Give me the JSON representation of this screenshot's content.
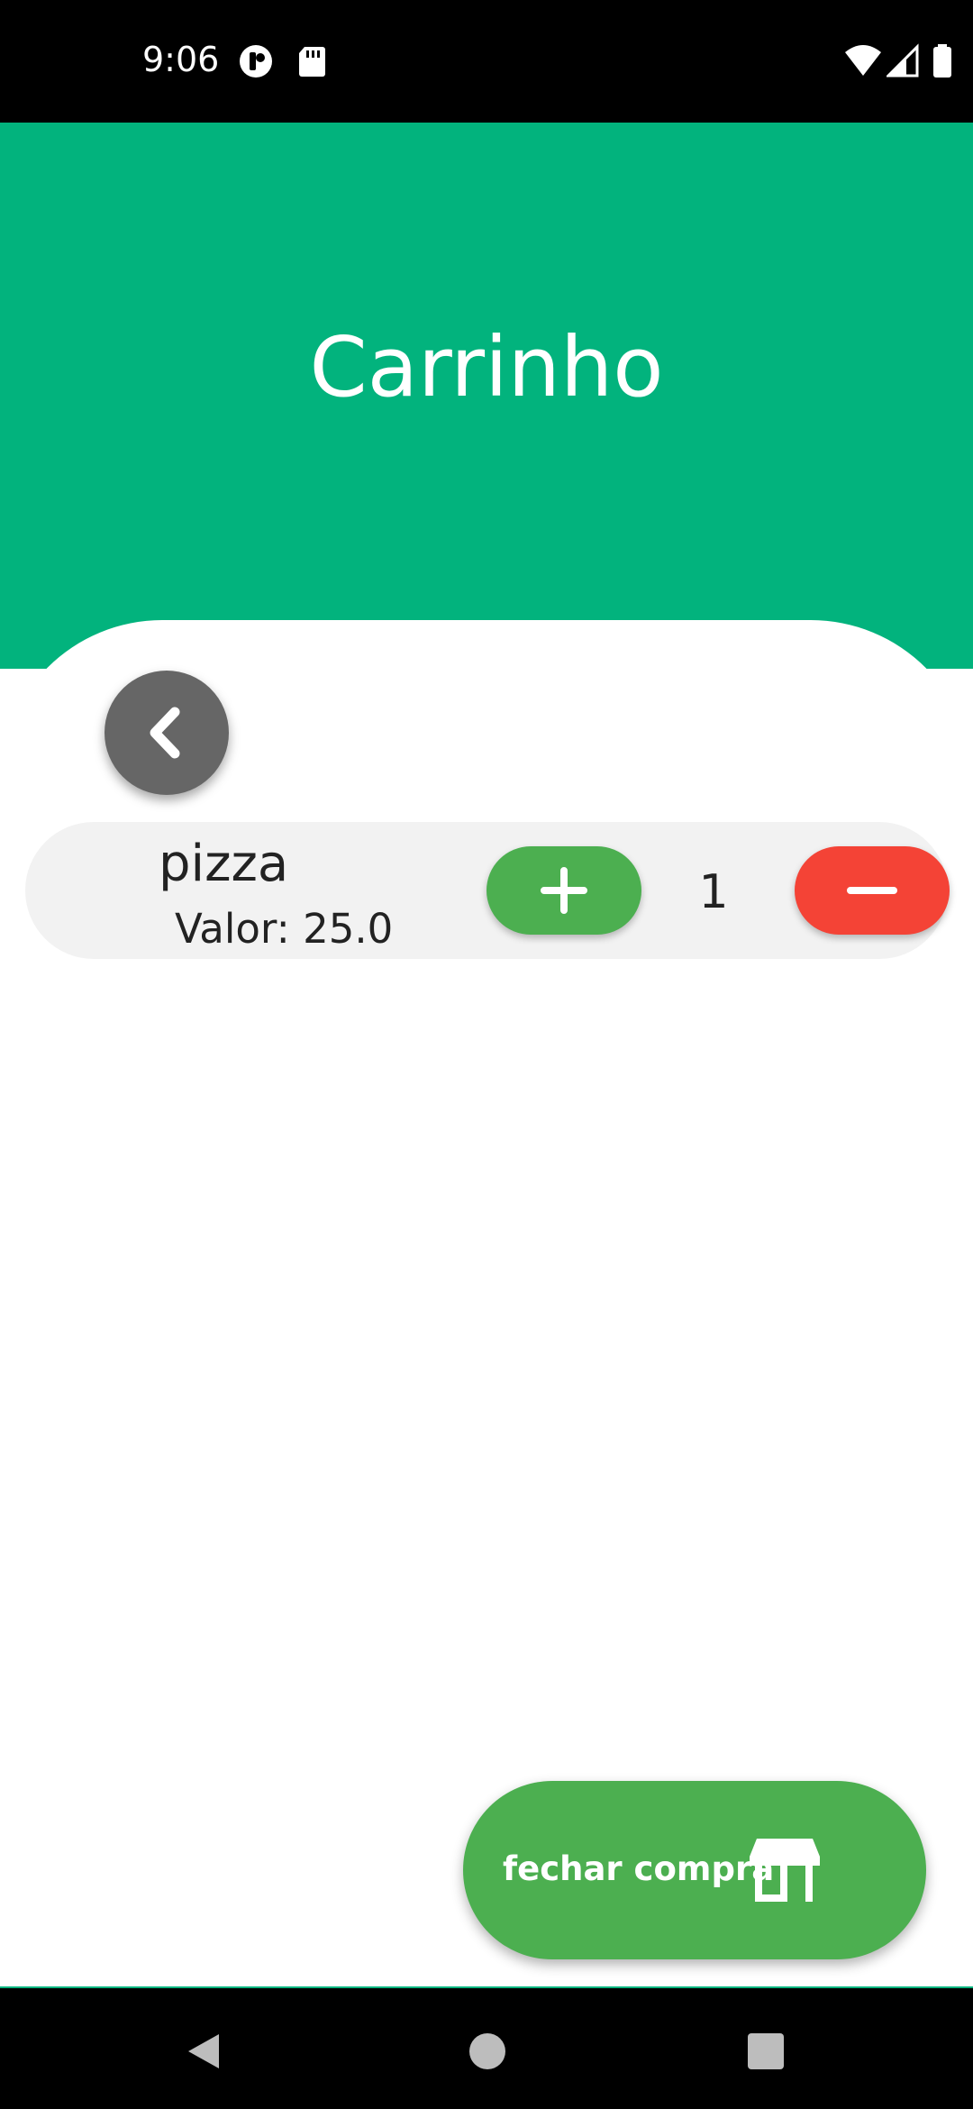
{
  "status_bar": {
    "time": "9:06",
    "icons": [
      "app-notification-icon",
      "sd-card-icon",
      "wifi-icon",
      "cell-signal-icon",
      "battery-icon"
    ]
  },
  "header": {
    "title": "Carrinho",
    "color": "#02b37d"
  },
  "back_button": {
    "icon": "chevron-left-icon",
    "color": "#666666"
  },
  "cart": {
    "items": [
      {
        "name": "pizza",
        "price_label": "Valor: 25.0",
        "quantity": "1"
      }
    ],
    "plus_color": "#4caf50",
    "minus_color": "#f44336"
  },
  "checkout": {
    "label": "fechar compra",
    "icon": "store-icon",
    "color": "#4caf50"
  },
  "nav_bar": {
    "buttons": [
      "back-triangle-icon",
      "home-circle-icon",
      "recents-square-icon"
    ]
  }
}
